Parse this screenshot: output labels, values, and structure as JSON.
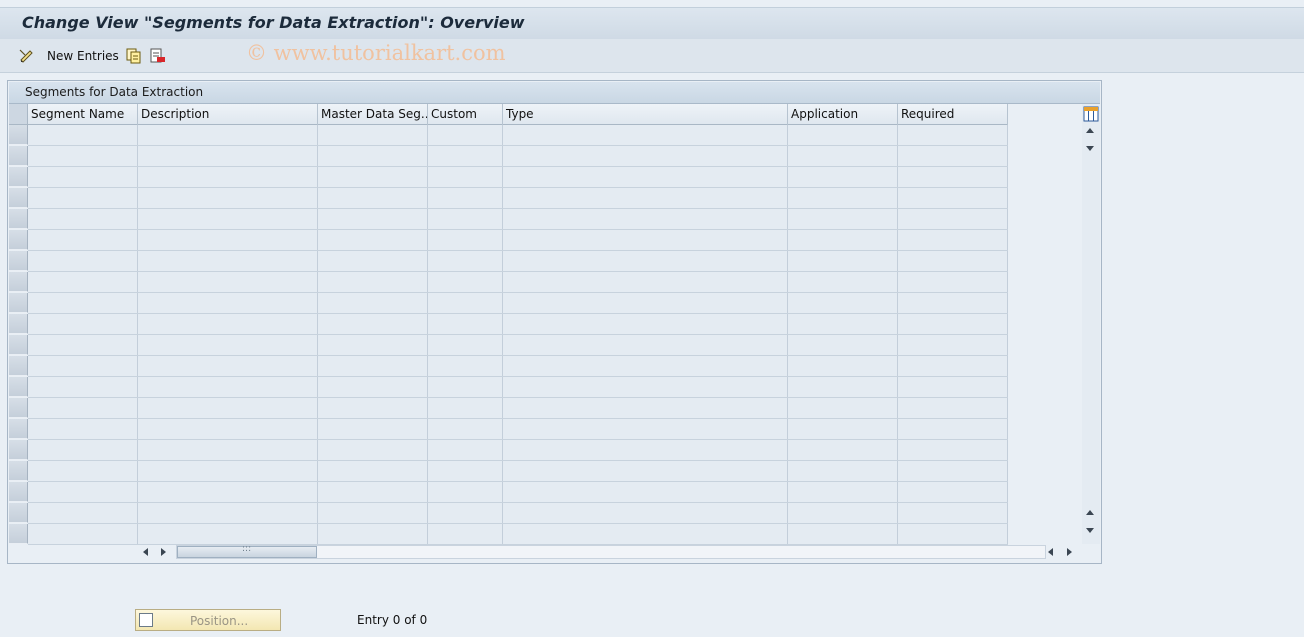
{
  "title": "Change View \"Segments for Data Extraction\": Overview",
  "toolbar": {
    "new_entries_label": "New Entries",
    "watermark": "© www.tutorialkart.com"
  },
  "table": {
    "caption": "Segments for Data Extraction",
    "columns": [
      "Segment Name",
      "Description",
      "Master Data Seg...",
      "Custom",
      "Type",
      "Application",
      "Required"
    ],
    "rows": [],
    "empty_row_count": 20
  },
  "footer": {
    "position_label": "Position...",
    "entry_info": "Entry 0 of 0"
  }
}
